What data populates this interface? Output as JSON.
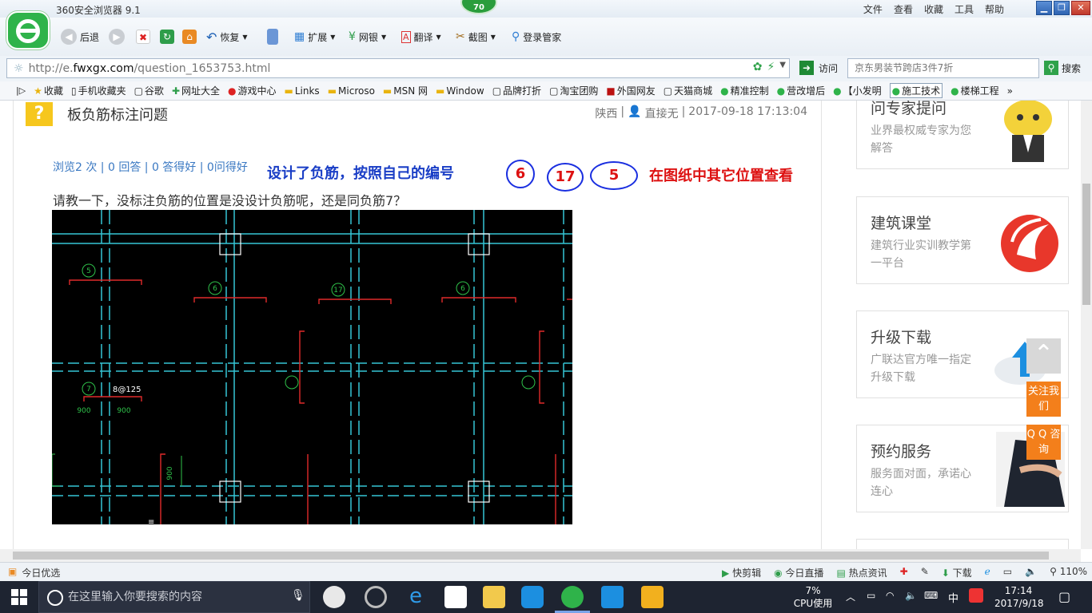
{
  "browser": {
    "title": "360安全浏览器 9.1",
    "badge": "70",
    "menu": [
      "文件",
      "查看",
      "收藏",
      "工具",
      "帮助"
    ],
    "toolbar": {
      "back": "后退",
      "restore": "恢复",
      "extend": "扩展",
      "netbank": "网银",
      "translate": "翻译",
      "screenshot": "截图",
      "login": "登录管家"
    },
    "address": {
      "prefix": "http://e.",
      "domain": "fwxgx.com",
      "path": "/question_1653753.html",
      "visit": "访问",
      "search_placeholder": "京东男装节跨店3件7折",
      "search_button": "搜索"
    },
    "bookmarks": [
      "收藏",
      "手机收藏夹",
      "谷歌",
      "网址大全",
      "游戏中心",
      "Links",
      "Microso",
      "MSN 网",
      "Window",
      "品牌打折",
      "淘宝团购",
      "外国网友",
      "天猫商城",
      "精准控制",
      "营改增后",
      "【小发明",
      "施工技术",
      "楼梯工程"
    ]
  },
  "question": {
    "title": "板负筋标注问题",
    "region": "陕西",
    "author": "直接无",
    "datetime": "2017-09-18 17:13:04",
    "stats": "浏览2 次 | 0 回答 | 0 答得好 | 0问得好",
    "annotation": "设计了负筋，按照自己的编号",
    "circles": [
      "6",
      "17",
      "5"
    ],
    "annotation2": "在图纸中其它位置查看",
    "body": "请教一下，没标注负筋的位置是没设计负筋呢，还是同负筋7？",
    "cad_labels": [
      "5",
      "6",
      "17",
      "6",
      "7",
      "8@125",
      "900",
      "900",
      "900"
    ]
  },
  "sidebar": {
    "cards": [
      {
        "title": "问专家提问",
        "sub": "业界最权威专家为您解答"
      },
      {
        "title": "建筑课堂",
        "sub": "建筑行业实训教学第一平台"
      },
      {
        "title": "升级下载",
        "sub": "广联达官方唯一指定升级下载"
      },
      {
        "title": "预约服务",
        "sub": "服务面对面，承诺心连心"
      }
    ],
    "float_follow": "关注我们",
    "float_qq": "Q Q 咨询"
  },
  "statusbar": {
    "left": "今日优选",
    "items": [
      "快剪辑",
      "今日直播",
      "热点资讯",
      "下载",
      "110%"
    ]
  },
  "taskbar": {
    "search_placeholder": "在这里输入你要搜索的内容",
    "cpu_percent": "7%",
    "cpu_label": "CPU使用",
    "lang": "中",
    "time": "17:14",
    "date": "2017/9/18"
  },
  "colors": {
    "accent_green": "#2fb34a",
    "annotation_blue": "#1a3ec6",
    "annotation_red": "#d11111",
    "float_orange": "#f37f1b"
  }
}
